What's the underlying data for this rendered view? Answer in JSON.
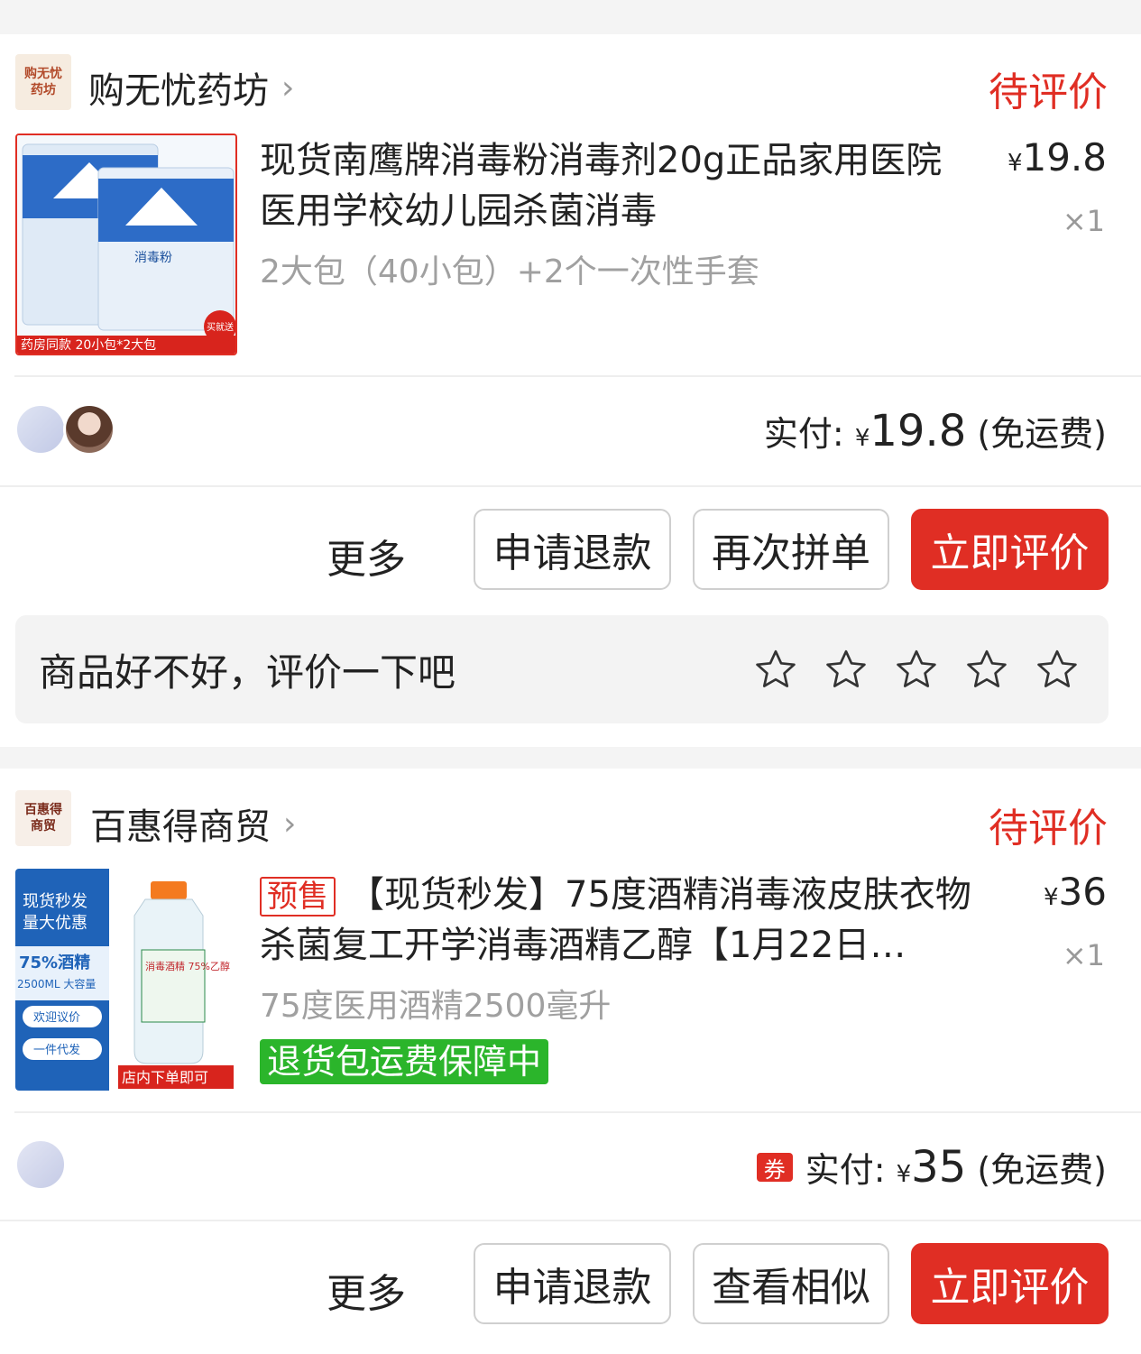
{
  "orders": [
    {
      "shop_logo_text": "购无忧药坊",
      "shop_name": "购无忧药坊",
      "status": "待评价",
      "product_title": "现货南鹰牌消毒粉消毒剂20g正品家用医院医用学校幼儿园杀菌消毒",
      "spec": "2大包（40小包）+2个一次性手套",
      "price_symbol": "¥",
      "price": "19.8",
      "qty": "×1",
      "thumb_caption": "药房同款 20小包*2大包",
      "thumb_badge": "买就送",
      "thumb_pkg_label": "消毒粉",
      "paid_label": "实付:",
      "paid_symbol": "¥",
      "paid_amount": "19.8",
      "shipping": "(免运费)",
      "more_label": "更多",
      "buttons": [
        "申请退款",
        "再次拼单",
        "立即评价"
      ],
      "review_prompt": "商品好不好，评价一下吧",
      "stars": 5
    },
    {
      "shop_logo_text": "百惠得商贸",
      "shop_name": "百惠得商贸",
      "status": "待评价",
      "presale_tag": "预售",
      "product_title": "【现货秒发】75度酒精消毒液皮肤衣物杀菌复工开学消毒酒精乙醇【1月22日…",
      "spec": "75度医用酒精2500毫升",
      "guarantee": "退货包运费保障中",
      "price_symbol": "¥",
      "price": "36",
      "qty": "×1",
      "thumb_lines": [
        "现货秒发",
        "量大优惠",
        "75%酒精",
        "2500ML 大容量"
      ],
      "thumb_pills": [
        "欢迎议价",
        "一件代发"
      ],
      "thumb_caption": "店内下单即可",
      "thumb_bottle_label": "消毒酒精 75%乙醇",
      "coupon": "券",
      "paid_label": "实付:",
      "paid_symbol": "¥",
      "paid_amount": "35",
      "shipping": "(免运费)",
      "more_label": "更多",
      "buttons": [
        "申请退款",
        "查看相似",
        "立即评价"
      ]
    }
  ],
  "colors": {
    "accent_red": "#e02e24",
    "guarantee_green": "#2bb52b",
    "muted": "#a0a0a0"
  }
}
